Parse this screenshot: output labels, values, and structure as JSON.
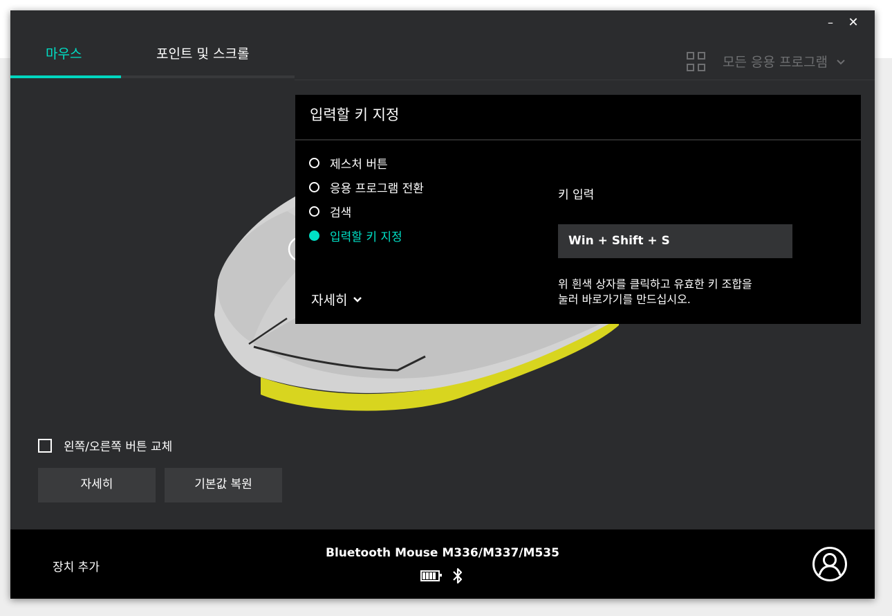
{
  "window": {
    "minimize": "–",
    "close": "✕"
  },
  "tabs": [
    {
      "label": "마우스",
      "active": true
    },
    {
      "label": "포인트 및 스크롤",
      "active": false
    }
  ],
  "app_filter": {
    "icon": "grid-icon",
    "label": "모든 응용 프로그램"
  },
  "panel": {
    "title": "입력할 키 지정",
    "options": [
      {
        "label": "제스처 버튼",
        "selected": false
      },
      {
        "label": "응용 프로그램 전환",
        "selected": false
      },
      {
        "label": "검색",
        "selected": false
      },
      {
        "label": "입력할 키 지정",
        "selected": true
      }
    ],
    "details_label": "자세히",
    "key_input_label": "키 입력",
    "key_value": "Win + Shift + S",
    "help_line1": "위 흰색 상자를 클릭하고 유효한 키 조합을",
    "help_line2": "눌러 바로가기를 만드십시오."
  },
  "left": {
    "swap_label": "왼쪽/오른쪽 버튼 교체",
    "swap_checked": false,
    "details_button": "자세히",
    "reset_button": "기본값 복원"
  },
  "footer": {
    "add_device": "장치 추가",
    "device_name": "Bluetooth Mouse M336/M337/M535",
    "icons": [
      "battery-icon",
      "bluetooth-icon",
      "account-icon"
    ]
  },
  "colors": {
    "accent": "#00e0c6",
    "window_bg": "#2b2c2e",
    "panel_bg": "#000000",
    "mouse_trim": "#d6d81c"
  }
}
